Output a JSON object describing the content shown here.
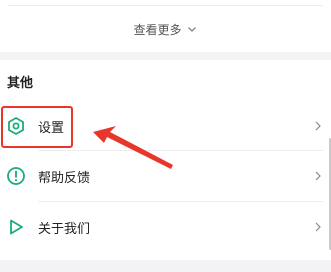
{
  "see_more": {
    "label": "查看更多",
    "icon": "chevron-down-icon"
  },
  "section": {
    "title": "其他",
    "items": [
      {
        "label": "设置",
        "icon": "settings-hexagon-icon"
      },
      {
        "label": "帮助反馈",
        "icon": "help-exclamation-icon"
      },
      {
        "label": "关于我们",
        "icon": "about-play-icon"
      }
    ]
  },
  "colors": {
    "accent_green": "#1aad7a",
    "highlight_red": "#e8362a",
    "background": "#f3f3f5"
  }
}
